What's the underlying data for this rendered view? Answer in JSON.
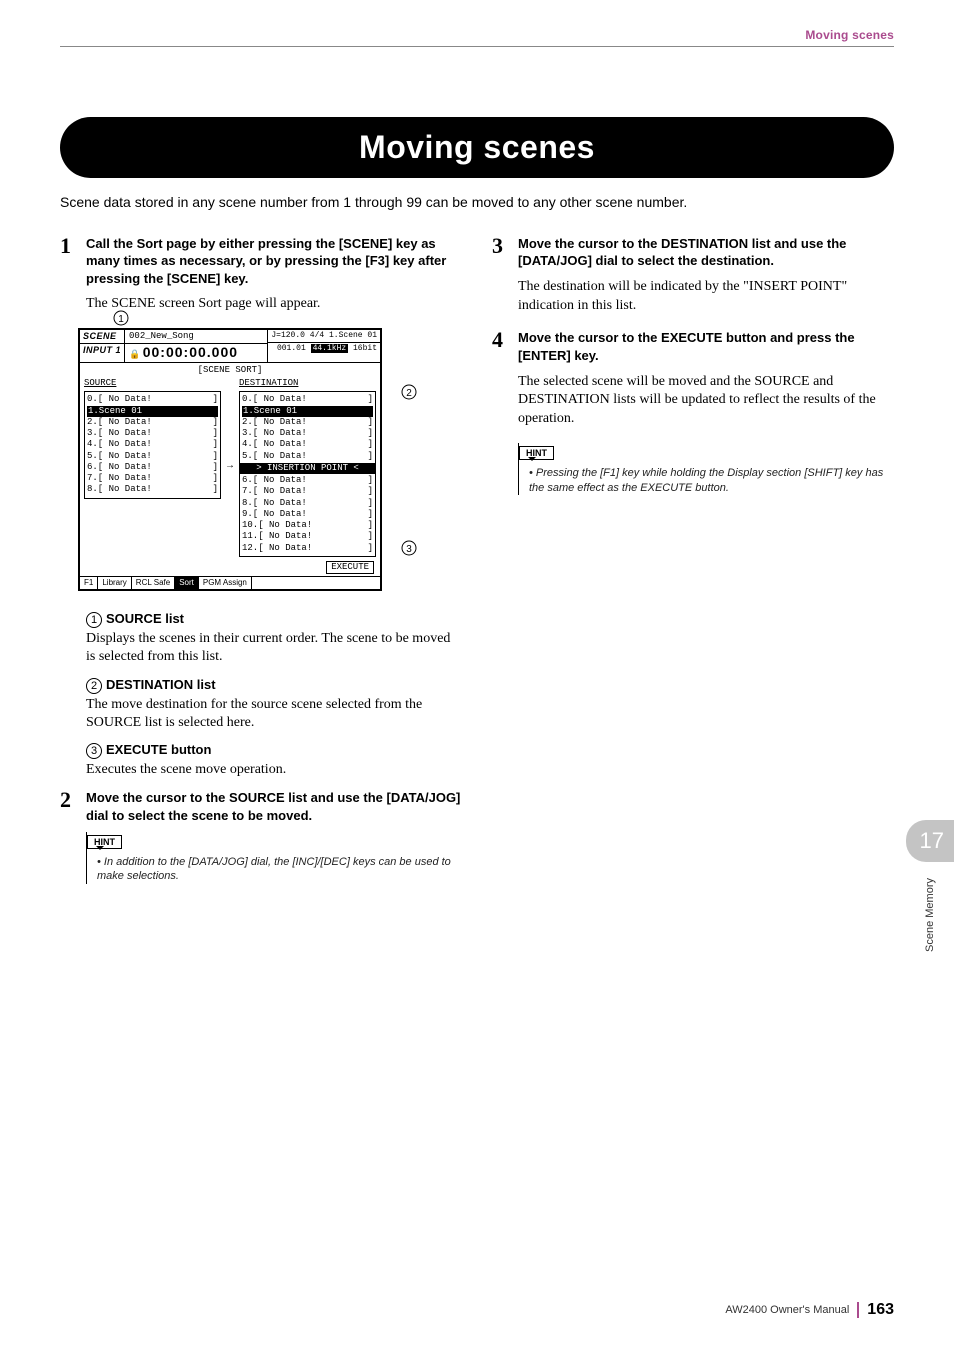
{
  "header": {
    "breadcrumb": "Moving scenes"
  },
  "title": "Moving scenes",
  "intro": "Scene data stored in any scene number from 1 through 99 can be moved to any other scene number.",
  "left": {
    "step1": {
      "num": "1",
      "heading": "Call the Sort page by either pressing the [SCENE] key as many times as necessary, or by pressing the [F3] key after pressing the [SCENE] key.",
      "text": "The SCENE screen Sort page will appear."
    },
    "def1": {
      "title": "SOURCE list",
      "text": "Displays the scenes in their current order. The scene to be moved is selected from this list."
    },
    "def2": {
      "title": "DESTINATION list",
      "text": "The move destination for the source scene selected from the SOURCE list is selected here."
    },
    "def3": {
      "title": "EXECUTE button",
      "text": "Executes the scene move operation."
    },
    "step2": {
      "num": "2",
      "heading": "Move the cursor to the SOURCE list and use the [DATA/JOG] dial to select the scene to be moved."
    },
    "hint": {
      "label": "HINT",
      "text": "In addition to the [DATA/JOG] dial, the [INC]/[DEC] keys can be used to make selections."
    }
  },
  "right": {
    "step3": {
      "num": "3",
      "heading": "Move the cursor to the DESTINATION list and use the [DATA/JOG] dial to select the destination.",
      "text": "The destination will be indicated by the \"INSERT POINT\" indication in this list."
    },
    "step4": {
      "num": "4",
      "heading": "Move the cursor to the EXECUTE button and press the [ENTER] key.",
      "text": "The selected scene will be moved and the SOURCE and DESTINATION lists will be updated to reflect the results of the operation."
    },
    "hint": {
      "label": "HINT",
      "text": "Pressing the [F1] key while holding the Display section [SHIFT] key has the same effect as the EXECUTE button."
    }
  },
  "screen": {
    "header": {
      "scene": "SCENE",
      "input": "INPUT 1",
      "song": "002_New_Song",
      "time": "00:00:00.000",
      "tempo": "J=120.0",
      "sig": "4/4",
      "bar": "001.01",
      "rate": "44.1kHz",
      "bit": "16bit",
      "current": "1.Scene 01"
    },
    "sort_label": "SCENE SORT",
    "source": {
      "header": "SOURCE",
      "pre": [
        {
          "n": "0.",
          "t": "No Data!",
          "r": "]"
        }
      ],
      "sel": "1.Scene 01",
      "post": [
        {
          "n": "2.",
          "t": "No Data!",
          "r": "]"
        },
        {
          "n": "3.",
          "t": "No Data!",
          "r": "]"
        },
        {
          "n": "4.",
          "t": "No Data!",
          "r": "]"
        },
        {
          "n": "5.",
          "t": "No Data!",
          "r": "]"
        },
        {
          "n": "6.",
          "t": "No Data!",
          "r": "]"
        },
        {
          "n": "7.",
          "t": "No Data!",
          "r": "]"
        },
        {
          "n": "8.",
          "t": "No Data!",
          "r": "]"
        }
      ]
    },
    "dest": {
      "header": "DESTINATION",
      "pre": [
        {
          "n": "0.",
          "t": "No Data!",
          "r": "]"
        }
      ],
      "sel": "1.Scene 01",
      "insertion": "> INSERTION POINT <",
      "mid": [
        {
          "n": "2.",
          "t": "No Data!",
          "r": "]"
        },
        {
          "n": "3.",
          "t": "No Data!",
          "r": "]"
        },
        {
          "n": "4.",
          "t": "No Data!",
          "r": "]"
        },
        {
          "n": "5.",
          "t": "No Data!",
          "r": "]"
        }
      ],
      "post": [
        {
          "n": "6.",
          "t": "No Data!",
          "r": "]"
        },
        {
          "n": "7.",
          "t": "No Data!",
          "r": "]"
        },
        {
          "n": "8.",
          "t": "No Data!",
          "r": "]"
        },
        {
          "n": "9.",
          "t": "No Data!",
          "r": "]"
        },
        {
          "n": "10.",
          "t": "No Data!",
          "r": "]"
        },
        {
          "n": "11.",
          "t": "No Data!",
          "r": "]"
        },
        {
          "n": "12.",
          "t": "No Data!",
          "r": "]"
        }
      ]
    },
    "execute": "EXECUTE",
    "tabs": [
      "F1",
      "Library",
      "RCL Safe",
      "Sort",
      "PGM Assign"
    ]
  },
  "circles": {
    "c1": "1",
    "c2": "2",
    "c3": "3"
  },
  "chapter": {
    "num": "17",
    "label": "Scene Memory"
  },
  "footer": {
    "manual": "AW2400  Owner's Manual",
    "page": "163"
  }
}
